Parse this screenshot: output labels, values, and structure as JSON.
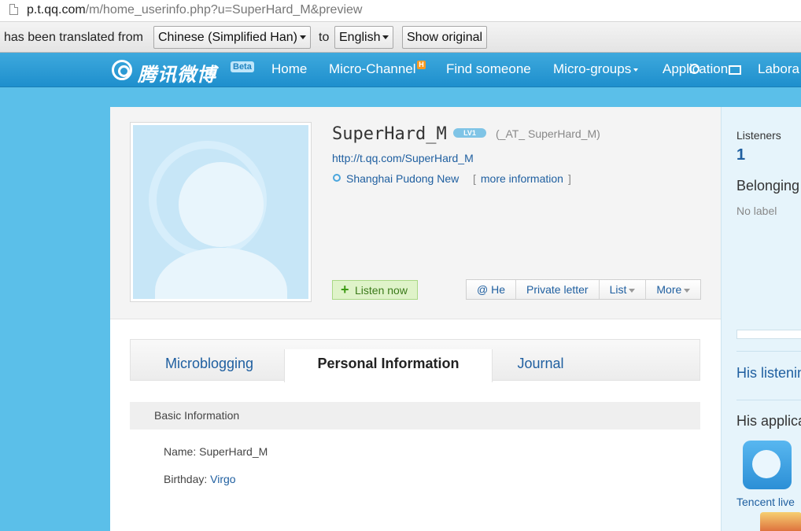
{
  "address_bar": {
    "url_host": "p.t.qq.com",
    "url_path": "/m/home_userinfo.php?u=SuperHard_M&preview"
  },
  "translate_bar": {
    "prefix": "has been translated from",
    "from_lang": "Chinese (Simplified Han)",
    "to_word": "to",
    "to_lang": "English",
    "show_original": "Show original"
  },
  "nav": {
    "logo": "腾讯微博",
    "beta": "Beta",
    "items": [
      "Home",
      "Micro-Channel",
      "Find someone",
      "Micro-groups",
      "Application",
      "Labora"
    ],
    "micro_channel_badge": "H"
  },
  "profile": {
    "username": "SuperHard_M",
    "level_badge": "LV1",
    "handle": "(_AT_ SuperHard_M)",
    "url": "http://t.qq.com/SuperHard_M",
    "location": "Shanghai Pudong New",
    "more_info_open": "[",
    "more_info": "more information",
    "more_info_close": "]",
    "listen_button": "Listen now",
    "actions": [
      "@ He",
      "Private letter",
      "List",
      "More"
    ]
  },
  "tabs": [
    "Microblogging",
    "Personal Information",
    "Journal"
  ],
  "active_tab": "Personal Information",
  "basic_info": {
    "title": "Basic Information",
    "name_label": "Name:",
    "name_value": "SuperHard_M",
    "birthday_label": "Birthday:",
    "birthday_value": "Virgo"
  },
  "sidebar": {
    "listeners_label": "Listeners",
    "listeners_count": "1",
    "belonging_label": "Belonging",
    "no_label": "No label",
    "his_listening": "His listenin",
    "his_applications": "His applica",
    "app_name": "Tencent live"
  },
  "colors": {
    "nav_bg": "#2a9ad6",
    "link": "#1f5fa0",
    "page_bg": "#5bbfe9"
  }
}
